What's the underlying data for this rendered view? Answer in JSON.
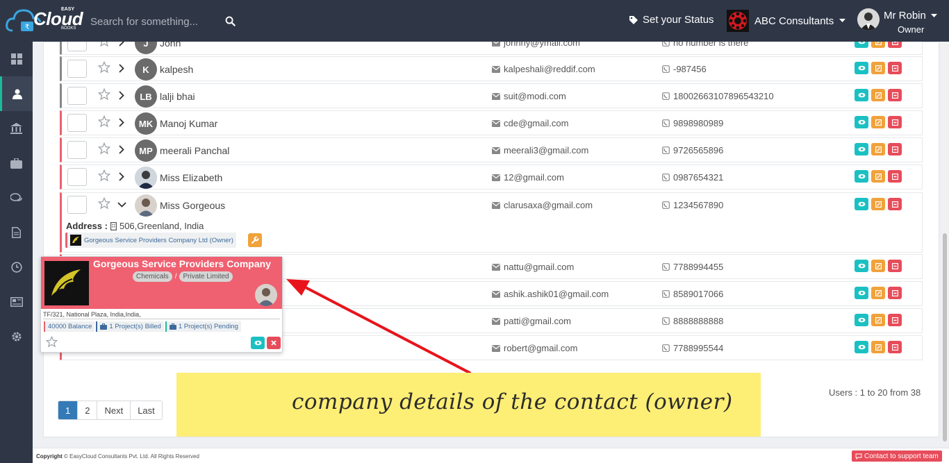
{
  "header": {
    "brand": "Cloud",
    "brand_top": "EASY",
    "brand_bottom": "BOOKS",
    "search_placeholder": "Search for something...",
    "status_label": "Set your Status",
    "company_name": "ABC Consultants",
    "user_name": "Mr Robin",
    "user_role": "Owner"
  },
  "sidebar": {
    "items": [
      "dashboard",
      "contacts",
      "bank",
      "projects",
      "chat",
      "documents",
      "time",
      "news",
      "settings"
    ],
    "active": "contacts"
  },
  "contacts": [
    {
      "initials": "J",
      "name": "John",
      "email": "johnny@ymail.com",
      "phone": "no number is there"
    },
    {
      "initials": "K",
      "name": "kalpesh",
      "email": "kalpeshali@reddif.com",
      "phone": "-987456"
    },
    {
      "initials": "LB",
      "name": "lalji bhai",
      "email": "suit@modi.com",
      "phone": "18002663107896543210"
    },
    {
      "initials": "MK",
      "name": "Manoj Kumar",
      "email": "cde@gmail.com",
      "phone": "9898980989"
    },
    {
      "initials": "MP",
      "name": "meerali Panchal",
      "email": "meerali3@gmail.com",
      "phone": "9726565896"
    },
    {
      "initials": "",
      "name": "Miss Elizabeth",
      "email": "12@gmail.com",
      "phone": "0987654321"
    },
    {
      "initials": "",
      "name": "Miss Gorgeous",
      "email": "clarusaxa@gmail.com",
      "phone": "1234567890"
    },
    {
      "initials": "",
      "name": "",
      "email": "nattu@gmail.com",
      "phone": "7788994455"
    },
    {
      "initials": "",
      "name": "",
      "email": "ashik.ashik01@gmail.com",
      "phone": "8589017066"
    },
    {
      "initials": "",
      "name": "",
      "email": "patti@gmail.com",
      "phone": "8888888888"
    },
    {
      "initials": "",
      "name": "",
      "email": "robert@gmail.com",
      "phone": "7788995544"
    }
  ],
  "expanded": {
    "address_label": "Address :",
    "address": "506,Greenland, India",
    "company_chip": "Gorgeous Service Providers Company Ltd (Owner)"
  },
  "popup": {
    "title": "Gorgeous Service Providers Company",
    "tag1": "Chemicals",
    "tag_sep": "/",
    "tag2": "Private Limited",
    "address": "TF/321, National Plaza, India,India,",
    "balance": "40000 Balance",
    "billed": "1 Project(s) Billed",
    "pending": "1 Project(s) Pending"
  },
  "annotation": {
    "text": "company details of the contact (owner)",
    "arrow_color": "#e8141b",
    "note_color": "#fdee76"
  },
  "pagination": {
    "pages": [
      "1",
      "2"
    ],
    "next": "Next",
    "last": "Last",
    "summary": "Users : 1 to 20 from 38"
  },
  "footer": {
    "copyright_label": "Copyright",
    "copyright_text": "© EasyCloud Consultants Pvt. Ltd. All Rights Reserved",
    "support": "Contact to support team"
  },
  "colors": {
    "topbar": "#2f3747",
    "accent_pink": "#e8616e",
    "view": "#1bc0c2",
    "edit": "#f0a23b",
    "delete": "#e74c5a"
  }
}
